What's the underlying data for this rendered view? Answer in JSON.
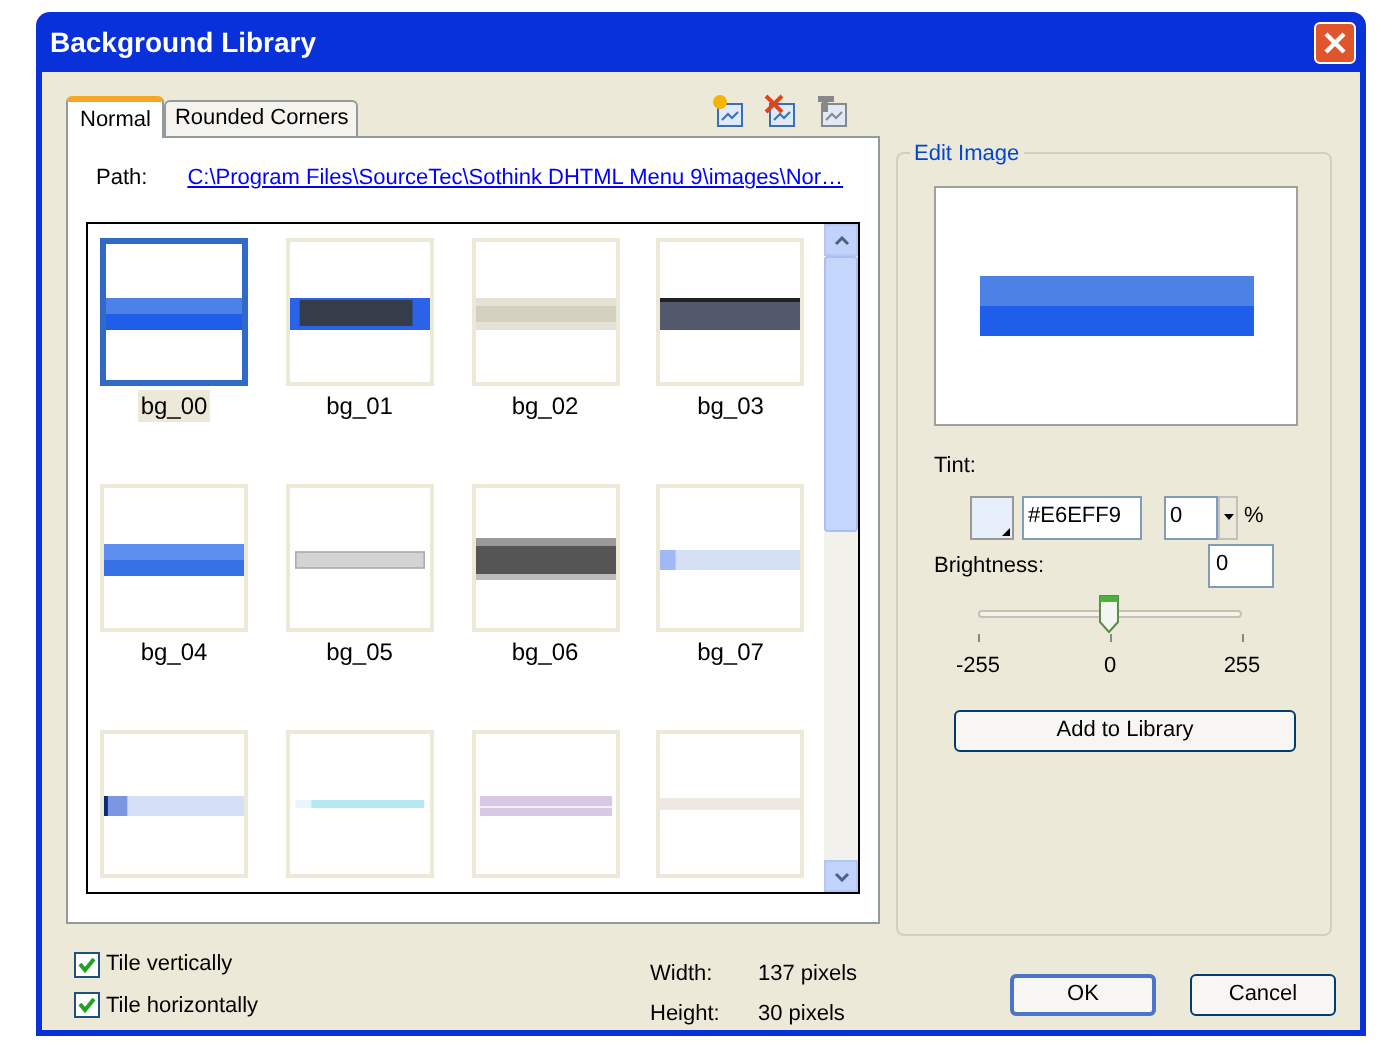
{
  "window": {
    "title": "Background Library"
  },
  "tabs": [
    {
      "label": "Normal",
      "selected": true
    },
    {
      "label": "Rounded Corners",
      "selected": false
    }
  ],
  "path": {
    "label": "Path:",
    "value": "C:\\Program Files\\SourceTec\\Sothink DHTML Menu 9\\images\\Nor…"
  },
  "images": [
    {
      "name": "bg_00",
      "selected": true
    },
    {
      "name": "bg_01",
      "selected": false
    },
    {
      "name": "bg_02",
      "selected": false
    },
    {
      "name": "bg_03",
      "selected": false
    },
    {
      "name": "bg_04",
      "selected": false
    },
    {
      "name": "bg_05",
      "selected": false
    },
    {
      "name": "bg_06",
      "selected": false
    },
    {
      "name": "bg_07",
      "selected": false
    },
    {
      "selected": false
    },
    {
      "selected": false
    },
    {
      "selected": false
    },
    {
      "selected": false
    }
  ],
  "edit_image": {
    "title": "Edit Image",
    "tint_label": "Tint:",
    "tint_value": "#E6EFF9",
    "tint_percent": "0",
    "percent_sign": "%",
    "brightness_label": "Brightness:",
    "brightness_value": "0",
    "brightness": {
      "level": 0.5,
      "ticks": [
        "-255",
        "0",
        "255"
      ]
    },
    "add_button": "Add to Library"
  },
  "options": [
    {
      "label": "Tile vertically",
      "checked": true
    },
    {
      "label": "Tile horizontally",
      "checked": true
    }
  ],
  "info": [
    {
      "label": "Width:",
      "value": "137 pixels"
    },
    {
      "label": "Height:",
      "value": "30 pixels"
    }
  ],
  "buttons": [
    {
      "label": "OK",
      "default": true
    },
    {
      "label": "Cancel",
      "default": false
    }
  ]
}
